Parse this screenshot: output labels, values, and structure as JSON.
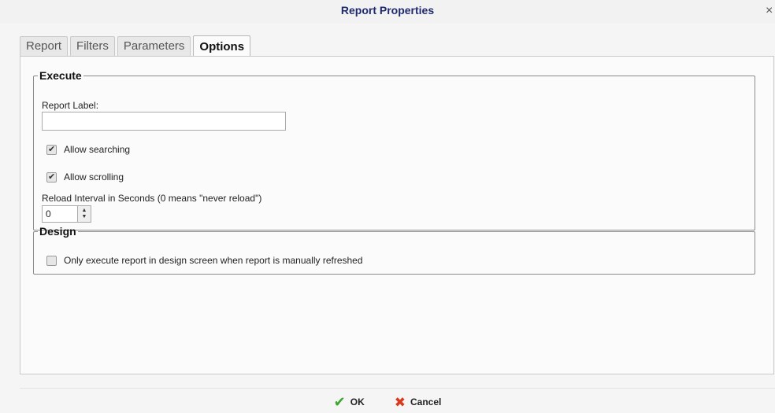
{
  "dialog": {
    "title": "Report Properties",
    "close_glyph": "×"
  },
  "tabs": [
    {
      "label": "Report"
    },
    {
      "label": "Filters"
    },
    {
      "label": "Parameters"
    },
    {
      "label": "Options",
      "active": true
    }
  ],
  "execute": {
    "legend": "Execute",
    "report_label_caption": "Report Label:",
    "report_label_value": "",
    "allow_searching": {
      "label": "Allow searching",
      "checked": true
    },
    "allow_scrolling": {
      "label": "Allow scrolling",
      "checked": true
    },
    "reload_caption": "Reload Interval in Seconds (0 means \"never reload\")",
    "reload_value": "0"
  },
  "design": {
    "legend": "Design",
    "only_execute": {
      "label": "Only execute report in design screen when report is manually refreshed",
      "checked": false
    }
  },
  "footer": {
    "ok_label": "OK",
    "cancel_label": "Cancel"
  },
  "colors": {
    "title": "#1f2a6e",
    "ok_icon": "#3aa62e",
    "cancel_icon": "#d93a1e"
  },
  "icons": {
    "ok": "checkmark-icon",
    "cancel": "x-icon",
    "close": "close-icon"
  }
}
